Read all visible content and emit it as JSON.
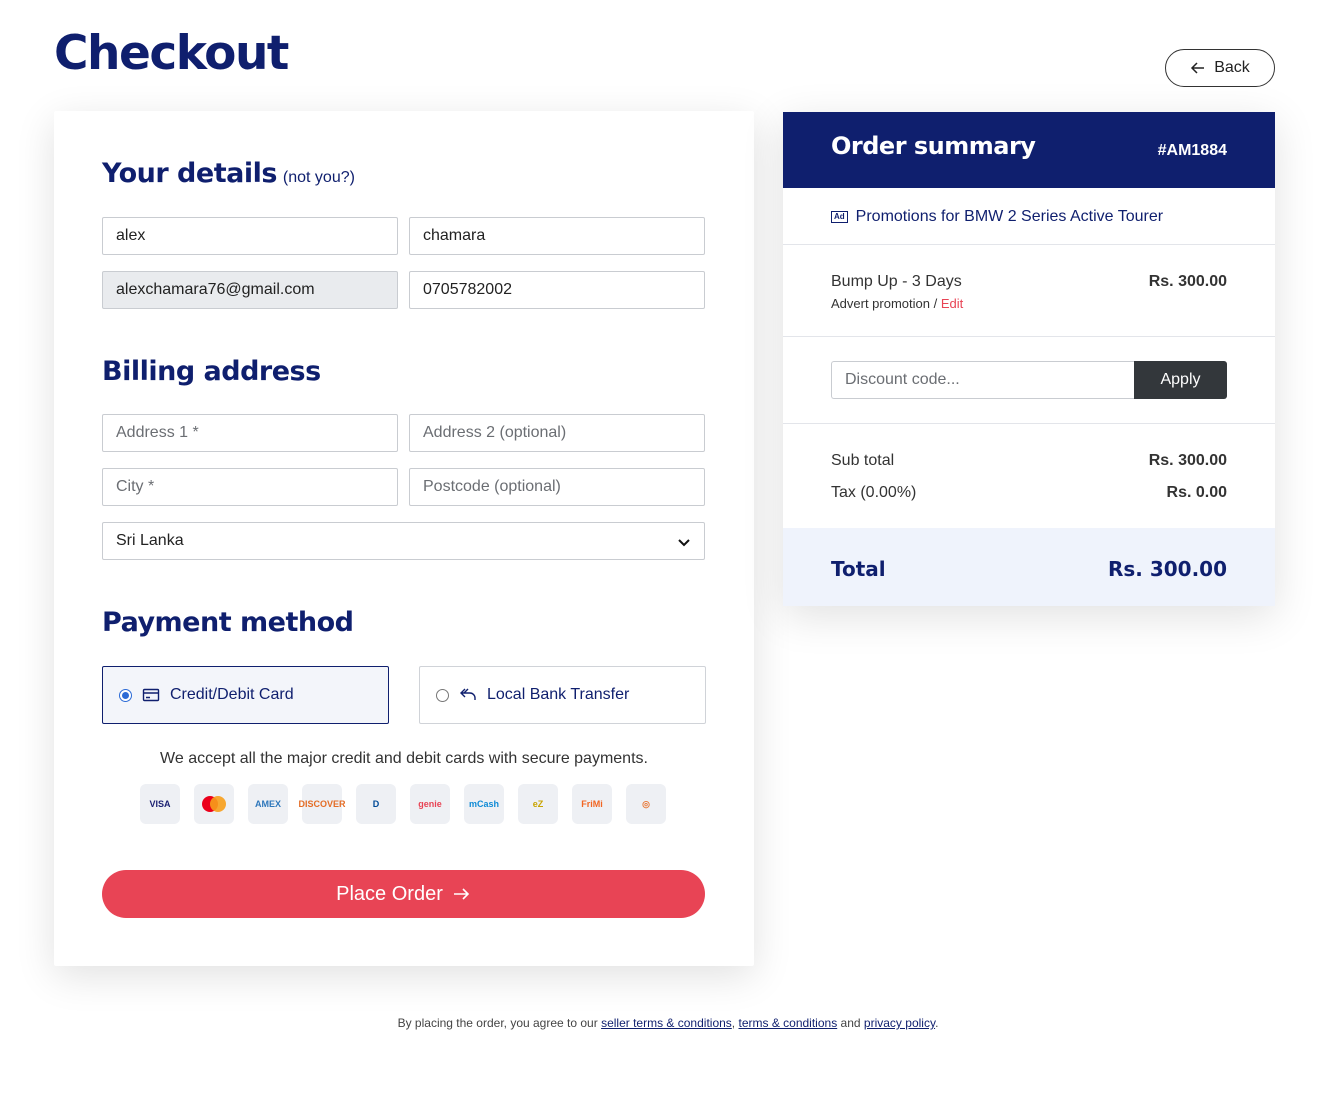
{
  "page": {
    "title": "Checkout",
    "back_label": "Back"
  },
  "details": {
    "title": "Your details",
    "not_you": "(not you?)",
    "first_name": "alex",
    "last_name": "chamara",
    "email": "alexchamara76@gmail.com",
    "phone": "0705782002"
  },
  "billing": {
    "title": "Billing address",
    "address1_placeholder": "Address 1 *",
    "address2_placeholder": "Address 2 (optional)",
    "city_placeholder": "City *",
    "postcode_placeholder": "Postcode (optional)",
    "country": "Sri Lanka"
  },
  "payment": {
    "title": "Payment method",
    "options": [
      {
        "label": "Credit/Debit Card",
        "selected": true,
        "icon": "credit-card-icon"
      },
      {
        "label": "Local Bank Transfer",
        "selected": false,
        "icon": "bank-transfer-icon"
      }
    ],
    "accept_text": "We accept all the major credit and debit cards with secure payments.",
    "logos": [
      {
        "name": "visa",
        "text": "VISA",
        "color": "#1a1f71"
      },
      {
        "name": "mastercard",
        "text": "",
        "color": "#eb001b"
      },
      {
        "name": "amex",
        "text": "AMEX",
        "color": "#2e77bb"
      },
      {
        "name": "discover",
        "text": "DISCOVER",
        "color": "#e46d26"
      },
      {
        "name": "diners-club",
        "text": "D",
        "color": "#004a97"
      },
      {
        "name": "genie",
        "text": "genie",
        "color": "#e84455"
      },
      {
        "name": "mcash",
        "text": "mCash",
        "color": "#0f8bd6"
      },
      {
        "name": "ezcash",
        "text": "eZ",
        "color": "#c9a400"
      },
      {
        "name": "frimi",
        "text": "FriMi",
        "color": "#f26522"
      },
      {
        "name": "other-wallet",
        "text": "◎",
        "color": "#e87a3a"
      }
    ],
    "place_order_label": "Place Order"
  },
  "summary": {
    "title": "Order summary",
    "order_id": "#AM1884",
    "ad_badge": "Ad",
    "promo_title": "Promotions for BMW 2 Series Active Tourer",
    "item_name": "Bump Up - 3 Days",
    "item_sub": "Advert promotion /",
    "item_edit": "Edit",
    "item_price": "Rs. 300.00",
    "discount_placeholder": "Discount code...",
    "apply_label": "Apply",
    "subtotal_label": "Sub total",
    "subtotal_value": "Rs. 300.00",
    "tax_label": "Tax (0.00%)",
    "tax_value": "Rs. 0.00",
    "total_label": "Total",
    "total_value": "Rs. 300.00"
  },
  "footer": {
    "prefix": "By placing the order, you agree to our",
    "link1": "seller terms & conditions",
    "sep1": ",",
    "link2": "terms & conditions",
    "and": "and",
    "link3": "privacy policy",
    "suffix": "."
  },
  "colors": {
    "brand": "#0f1f6e",
    "accent": "#e84455",
    "selected_radio": "#2c6bd6"
  }
}
